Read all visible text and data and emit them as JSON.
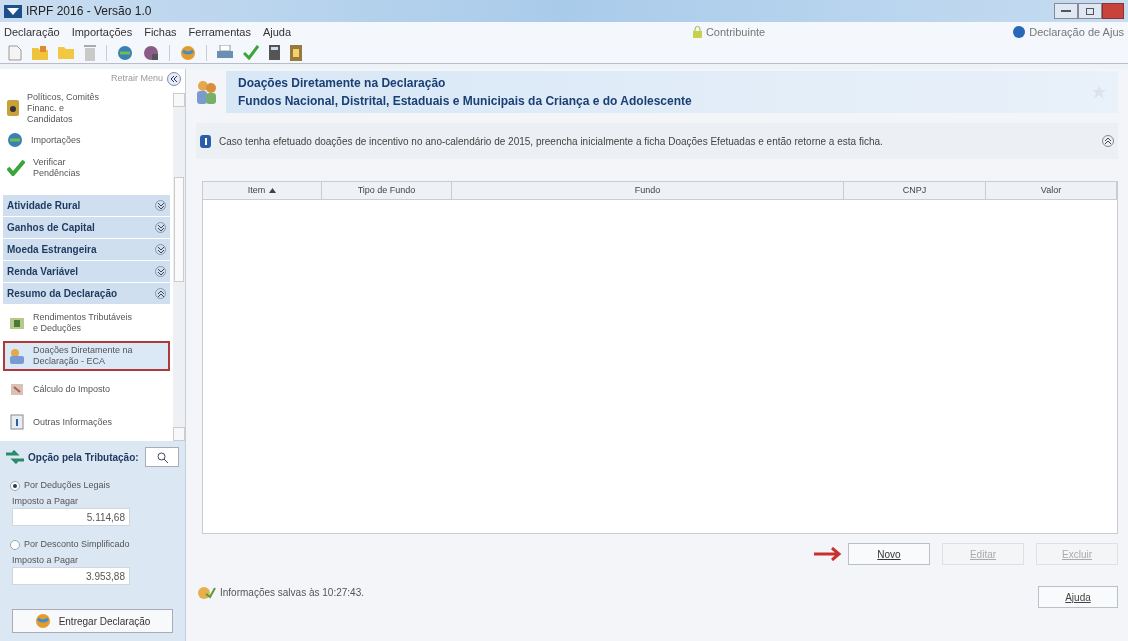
{
  "window": {
    "title": "IRPF 2016 - Versão 1.0"
  },
  "menu": [
    "Declaração",
    "Importações",
    "Fichas",
    "Ferramentas",
    "Ajuda"
  ],
  "contributor_label": "Contribuinte",
  "declaration_type": "Declaração de Ajus",
  "sidebar": {
    "collapse_label": "Retrair Menu",
    "top_items": [
      {
        "label": "Políticos, Comitês Financ. e Candidatos"
      },
      {
        "label": "Importações"
      },
      {
        "label": "Verificar Pendências"
      }
    ],
    "sections": [
      {
        "label": "Atividade Rural",
        "expanded": false
      },
      {
        "label": "Ganhos de Capital",
        "expanded": false
      },
      {
        "label": "Moeda Estrangeira",
        "expanded": false
      },
      {
        "label": "Renda Variável",
        "expanded": false
      },
      {
        "label": "Resumo da Declaração",
        "expanded": true
      }
    ],
    "items": [
      {
        "label": "Rendimentos Tributáveis e Deduções",
        "selected": false
      },
      {
        "label": "Doações Diretamente na Declaração - ECA",
        "selected": true
      },
      {
        "label": "Cálculo do Imposto",
        "selected": false
      },
      {
        "label": "Outras Informações",
        "selected": false
      }
    ],
    "tax_option": {
      "title": "Opção pela Tributação:",
      "options": [
        {
          "label": "Por Deduções Legais",
          "selected": true,
          "field_label": "Imposto a Pagar",
          "value": "5.114,68"
        },
        {
          "label": "Por Desconto Simplificado",
          "selected": false,
          "field_label": "Imposto a Pagar",
          "value": "3.953,88"
        }
      ]
    },
    "submit_button": "Entregar Declaração"
  },
  "main": {
    "title": "Doações Diretamente na Declaração",
    "subtitle": "Fundos Nacional, Distrital, Estaduais e Municipais da Criança e do Adolescente",
    "info": "Caso tenha efetuado doações de incentivo no ano-calendário de 2015, preencha inicialmente a ficha Doações Efetuadas e então retorne a esta ficha.",
    "table": {
      "columns": [
        {
          "label": "Item",
          "sorted": true
        },
        {
          "label": "Tipo de Fundo",
          "sorted": false
        },
        {
          "label": "Fundo",
          "sorted": false
        },
        {
          "label": "CNPJ",
          "sorted": false
        },
        {
          "label": "Valor",
          "sorted": false
        }
      ]
    },
    "buttons": [
      {
        "label": "Novo",
        "disabled": false
      },
      {
        "label": "Editar",
        "disabled": true
      },
      {
        "label": "Excluir",
        "disabled": true
      }
    ]
  },
  "status_bar": {
    "text": "Informações salvas às 10:27:43.",
    "help_button": "Ajuda"
  }
}
